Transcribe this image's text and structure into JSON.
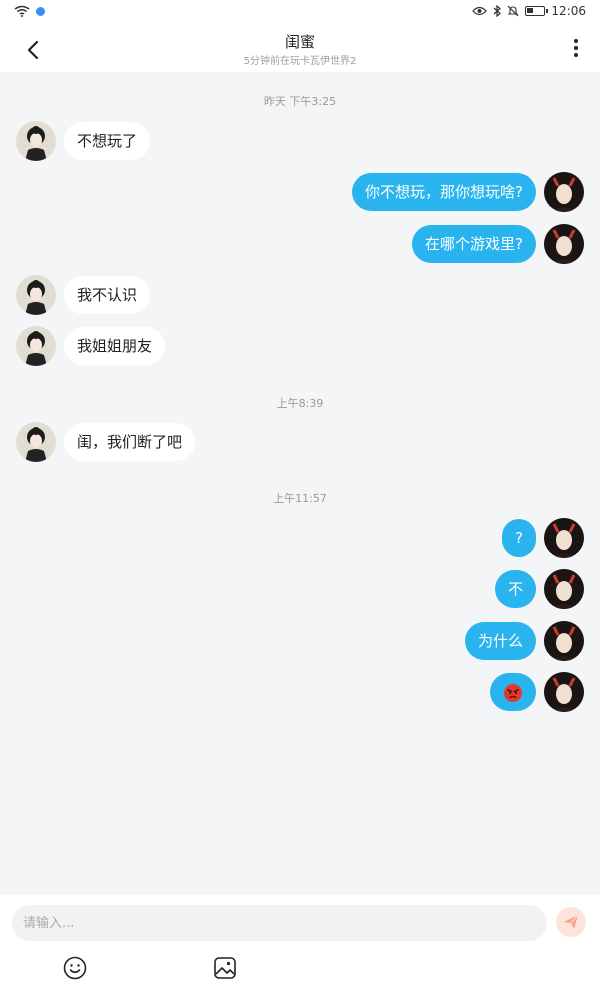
{
  "status_bar": {
    "time": "12:06",
    "battery_level": 0.4
  },
  "header": {
    "title": "闺蜜",
    "subtitle": "5分钟前在玩卡瓦伊世界2"
  },
  "messages": [
    {
      "type": "timestamp",
      "text": "昨天 下午3:25"
    },
    {
      "type": "message",
      "side": "left",
      "text": "不想玩了"
    },
    {
      "type": "message",
      "side": "right",
      "text": "你不想玩，那你想玩啥?"
    },
    {
      "type": "message",
      "side": "right",
      "text": "在哪个游戏里?"
    },
    {
      "type": "message",
      "side": "left",
      "text": "我不认识"
    },
    {
      "type": "message",
      "side": "left",
      "text": "我姐姐朋友"
    },
    {
      "type": "timestamp",
      "text": "上午8:39"
    },
    {
      "type": "message",
      "side": "left",
      "text": "闺，我们断了吧"
    },
    {
      "type": "timestamp",
      "text": "上午11:57"
    },
    {
      "type": "message",
      "side": "right",
      "text": "?"
    },
    {
      "type": "message",
      "side": "right",
      "text": "不"
    },
    {
      "type": "message",
      "side": "right",
      "text": "为什么"
    },
    {
      "type": "message",
      "side": "right",
      "emoji": "angry-face-emoji"
    }
  ],
  "input": {
    "placeholder": "请输入..."
  },
  "icons": {
    "back": "back-arrow-icon",
    "more": "more-vertical-icon",
    "send": "send-icon",
    "emoji_tool": "smiley-icon",
    "image_tool": "image-icon"
  },
  "colors": {
    "bubble_out": "#2ab4ef",
    "bubble_in": "#ffffff",
    "background": "#f3f5f7",
    "send_button": "#fde3dc"
  }
}
